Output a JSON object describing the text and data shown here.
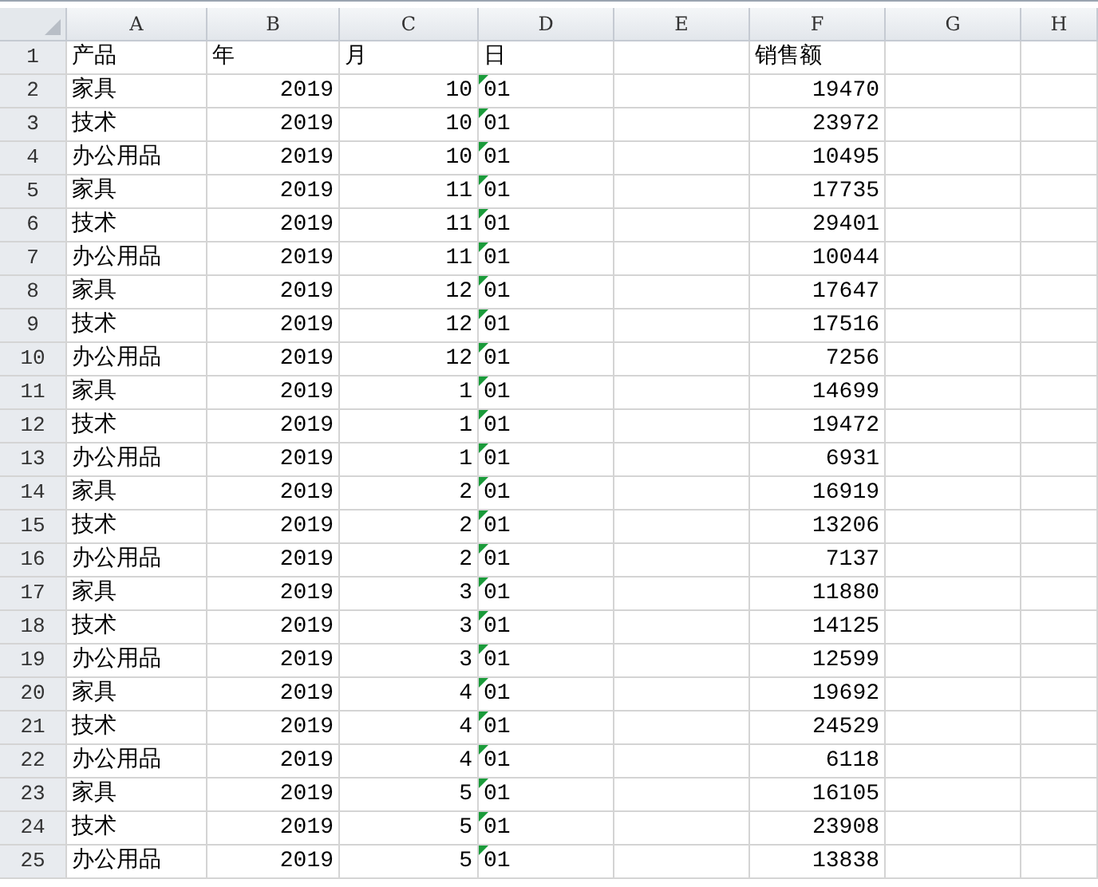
{
  "columns": [
    {
      "label": "A",
      "kind": "text"
    },
    {
      "label": "B",
      "kind": "number"
    },
    {
      "label": "C",
      "kind": "number"
    },
    {
      "label": "D",
      "kind": "text"
    },
    {
      "label": "E",
      "kind": "text"
    },
    {
      "label": "F",
      "kind": "number"
    },
    {
      "label": "G",
      "kind": "text"
    },
    {
      "label": "H",
      "kind": "text"
    }
  ],
  "rows": [
    {
      "num": "1",
      "header": true,
      "flagged": false,
      "cells": [
        "产品",
        "年",
        "月",
        "日",
        "",
        "销售额",
        "",
        ""
      ]
    },
    {
      "num": "2",
      "header": false,
      "flagged": true,
      "cells": [
        "家具",
        "2019",
        "10",
        "01",
        "",
        "19470",
        "",
        ""
      ]
    },
    {
      "num": "3",
      "header": false,
      "flagged": true,
      "cells": [
        "技术",
        "2019",
        "10",
        "01",
        "",
        "23972",
        "",
        ""
      ]
    },
    {
      "num": "4",
      "header": false,
      "flagged": true,
      "cells": [
        "办公用品",
        "2019",
        "10",
        "01",
        "",
        "10495",
        "",
        ""
      ]
    },
    {
      "num": "5",
      "header": false,
      "flagged": true,
      "cells": [
        "家具",
        "2019",
        "11",
        "01",
        "",
        "17735",
        "",
        ""
      ]
    },
    {
      "num": "6",
      "header": false,
      "flagged": true,
      "cells": [
        "技术",
        "2019",
        "11",
        "01",
        "",
        "29401",
        "",
        ""
      ]
    },
    {
      "num": "7",
      "header": false,
      "flagged": true,
      "cells": [
        "办公用品",
        "2019",
        "11",
        "01",
        "",
        "10044",
        "",
        ""
      ]
    },
    {
      "num": "8",
      "header": false,
      "flagged": true,
      "cells": [
        "家具",
        "2019",
        "12",
        "01",
        "",
        "17647",
        "",
        ""
      ]
    },
    {
      "num": "9",
      "header": false,
      "flagged": true,
      "cells": [
        "技术",
        "2019",
        "12",
        "01",
        "",
        "17516",
        "",
        ""
      ]
    },
    {
      "num": "10",
      "header": false,
      "flagged": true,
      "cells": [
        "办公用品",
        "2019",
        "12",
        "01",
        "",
        "7256",
        "",
        ""
      ]
    },
    {
      "num": "11",
      "header": false,
      "flagged": true,
      "cells": [
        "家具",
        "2019",
        "1",
        "01",
        "",
        "14699",
        "",
        ""
      ]
    },
    {
      "num": "12",
      "header": false,
      "flagged": true,
      "cells": [
        "技术",
        "2019",
        "1",
        "01",
        "",
        "19472",
        "",
        ""
      ]
    },
    {
      "num": "13",
      "header": false,
      "flagged": true,
      "cells": [
        "办公用品",
        "2019",
        "1",
        "01",
        "",
        "6931",
        "",
        ""
      ]
    },
    {
      "num": "14",
      "header": false,
      "flagged": true,
      "cells": [
        "家具",
        "2019",
        "2",
        "01",
        "",
        "16919",
        "",
        ""
      ]
    },
    {
      "num": "15",
      "header": false,
      "flagged": true,
      "cells": [
        "技术",
        "2019",
        "2",
        "01",
        "",
        "13206",
        "",
        ""
      ]
    },
    {
      "num": "16",
      "header": false,
      "flagged": true,
      "cells": [
        "办公用品",
        "2019",
        "2",
        "01",
        "",
        "7137",
        "",
        ""
      ]
    },
    {
      "num": "17",
      "header": false,
      "flagged": true,
      "cells": [
        "家具",
        "2019",
        "3",
        "01",
        "",
        "11880",
        "",
        ""
      ]
    },
    {
      "num": "18",
      "header": false,
      "flagged": true,
      "cells": [
        "技术",
        "2019",
        "3",
        "01",
        "",
        "14125",
        "",
        ""
      ]
    },
    {
      "num": "19",
      "header": false,
      "flagged": true,
      "cells": [
        "办公用品",
        "2019",
        "3",
        "01",
        "",
        "12599",
        "",
        ""
      ]
    },
    {
      "num": "20",
      "header": false,
      "flagged": true,
      "cells": [
        "家具",
        "2019",
        "4",
        "01",
        "",
        "19692",
        "",
        ""
      ]
    },
    {
      "num": "21",
      "header": false,
      "flagged": true,
      "cells": [
        "技术",
        "2019",
        "4",
        "01",
        "",
        "24529",
        "",
        ""
      ]
    },
    {
      "num": "22",
      "header": false,
      "flagged": true,
      "cells": [
        "办公用品",
        "2019",
        "4",
        "01",
        "",
        "6118",
        "",
        ""
      ]
    },
    {
      "num": "23",
      "header": false,
      "flagged": true,
      "cells": [
        "家具",
        "2019",
        "5",
        "01",
        "",
        "16105",
        "",
        ""
      ]
    },
    {
      "num": "24",
      "header": false,
      "flagged": true,
      "cells": [
        "技术",
        "2019",
        "5",
        "01",
        "",
        "23908",
        "",
        ""
      ]
    },
    {
      "num": "25",
      "header": false,
      "flagged": true,
      "cells": [
        "办公用品",
        "2019",
        "5",
        "01",
        "",
        "13838",
        "",
        ""
      ]
    }
  ]
}
